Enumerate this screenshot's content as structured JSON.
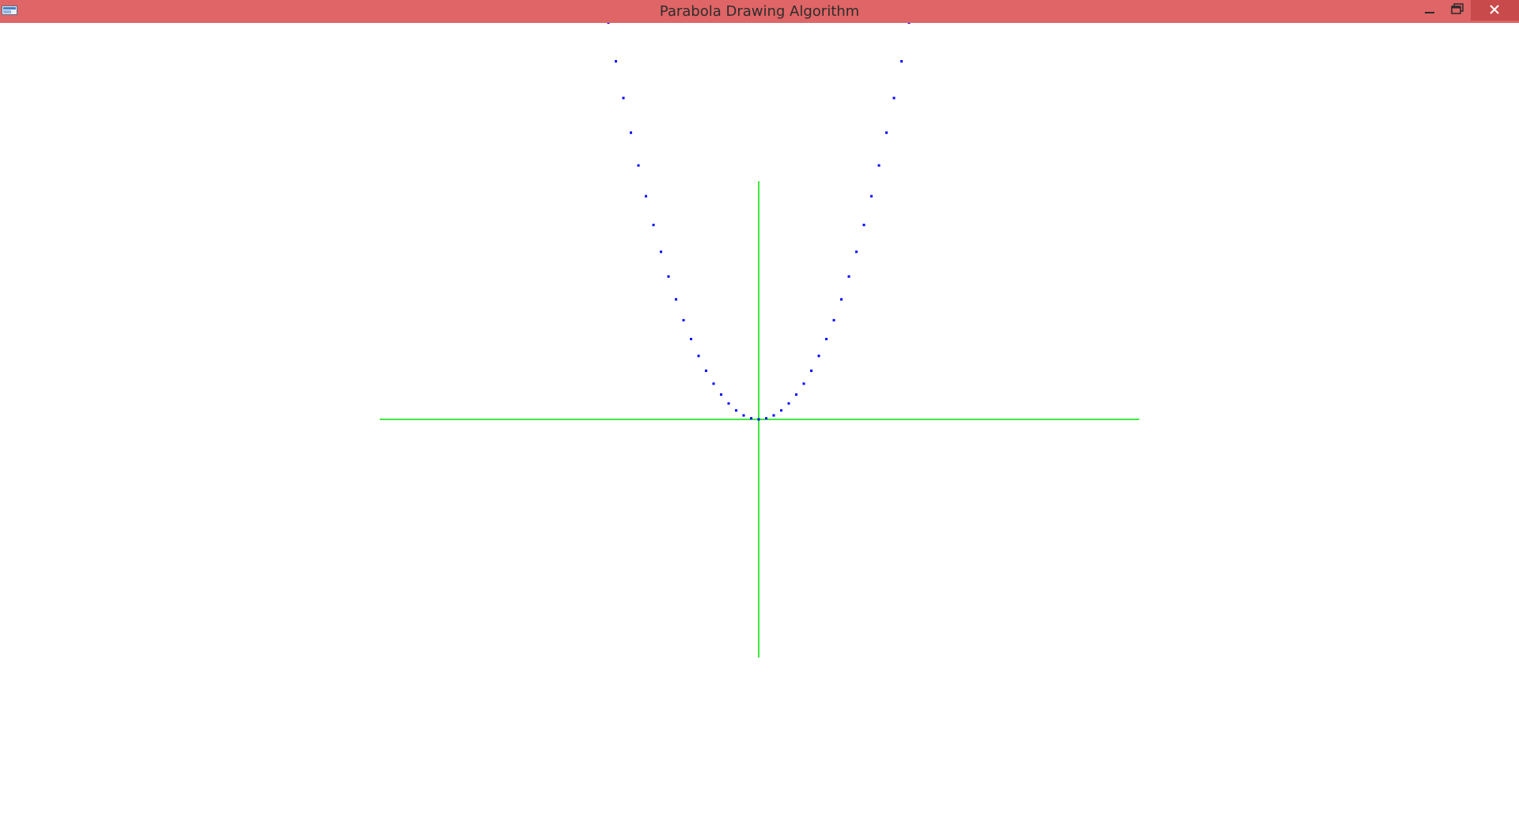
{
  "window": {
    "title": "Parabola Drawing Algorithm",
    "titlebar_color": "#df6566",
    "buttons": {
      "minimize": "minimize-icon",
      "maximize": "maximize-icon",
      "close": "close-icon"
    }
  },
  "plot": {
    "axis_color": "#00e000",
    "point_color": "#0000ff"
  }
}
